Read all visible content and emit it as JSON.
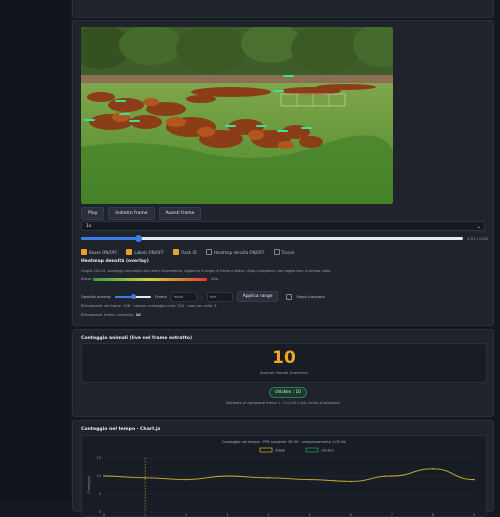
{
  "controls": {
    "play": "Play",
    "next": "Indietro frame",
    "prev": "Avanti frame",
    "speed": "1x",
    "time": "0:01 / 0:28",
    "progress": 0.15
  },
  "toggles": [
    {
      "label": "Boxes ON/OFF",
      "checked": true
    },
    {
      "label": "Labels ON/OFF",
      "checked": true
    },
    {
      "label": "Track ID",
      "checked": true
    },
    {
      "label": "Heatmap densità ON/OFF",
      "checked": false
    },
    {
      "label": "Tracce",
      "checked": false
    }
  ],
  "heatmap": {
    "title": "Heatmap densità (overlay)",
    "desc": "Griglia 20×15, conteggi cumulativi dei centri rilevamento. Aggiorna il range di frame e attiva «Segui playback» per aggiornare in tempo reale.",
    "low_label": "Bassa",
    "high_label": "Alta",
    "opacity_label": "Opacità overlay",
    "opacity": 0.5,
    "frame_label": "Frame",
    "from_placeholder": "inizio",
    "to_placeholder": "fine",
    "apply": "Applica range",
    "follow": "Segui playback",
    "note1": "Rilevamenti nel frame: 106 · nessun conteggio collo: 100 · max per cella: 3",
    "note2_prefix": "Rilevamenti (frame corrente):",
    "note2_value": "10"
  },
  "count": {
    "title": "Conteggio animali (live nel frame estratto)",
    "value": "10",
    "sub": "Animali rilevati (timeline)",
    "badge": "chicken : 10",
    "note": "Allineato al campione frame 1 · t=1.00 s (pt) vicino al playback"
  },
  "chart_card": {
    "title": "Conteggio nel tempo · Chart.js"
  },
  "chart_data": {
    "type": "line",
    "title": "Conteggio nel tempo · FPS sorgente 30.00 · campionamento 1.00 fot",
    "xlabel": "Indice frame (estratto)",
    "ylabel": "Conteggio",
    "x": [
      0,
      1,
      2,
      3,
      4,
      5,
      6,
      7,
      8,
      9
    ],
    "ylim": [
      0,
      15
    ],
    "yticks": [
      0,
      5,
      10,
      15
    ],
    "series": [
      {
        "name": "Totale",
        "color": "#c9a227",
        "values": [
          10,
          9.5,
          9,
          10,
          9.5,
          9,
          8.5,
          10,
          12,
          9
        ]
      },
      {
        "name": "chicken",
        "color": "#2d8f5e",
        "values": [
          10,
          9.5,
          9,
          10,
          9.5,
          9,
          8.5,
          10,
          12,
          9
        ]
      }
    ],
    "marker_x": 1,
    "legend": "top"
  }
}
